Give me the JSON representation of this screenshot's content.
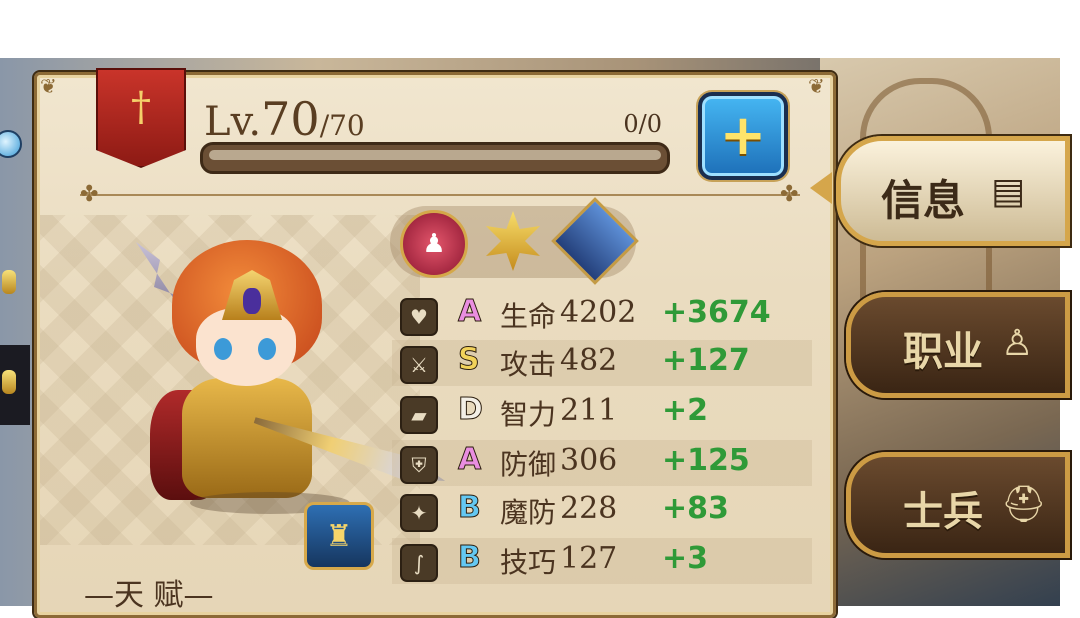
{
  "header": {
    "level_prefix": "Lv.",
    "level_current": "70",
    "level_max": "/70",
    "exp_text": "0/0",
    "exp_progress": 0,
    "plus_label": "+"
  },
  "role_icons": [
    "attack-class-icon",
    "star-rank-icon",
    "helmet-soldier-icon"
  ],
  "stats": [
    {
      "icon": "heart-icon",
      "icon_glyph": "♥",
      "grade": "A",
      "name": "生命",
      "value": "4202",
      "bonus": "+3674"
    },
    {
      "icon": "sword-icon",
      "icon_glyph": "⚔",
      "grade": "S",
      "name": "攻击",
      "value": "482",
      "bonus": "+127"
    },
    {
      "icon": "book-icon",
      "icon_glyph": "▰",
      "grade": "D",
      "name": "智力",
      "value": "211",
      "bonus": "+2"
    },
    {
      "icon": "shield-icon",
      "icon_glyph": "⛨",
      "grade": "A",
      "name": "防御",
      "value": "306",
      "bonus": "+125"
    },
    {
      "icon": "magic-shield-icon",
      "icon_glyph": "✦",
      "grade": "B",
      "name": "魔防",
      "value": "228",
      "bonus": "+83"
    },
    {
      "icon": "skill-icon",
      "icon_glyph": "∫",
      "grade": "B",
      "name": "技巧",
      "value": "127",
      "bonus": "+3"
    }
  ],
  "talent_label": "—天 赋—",
  "menu": {
    "info_label": "信息",
    "job_label": "职业",
    "soldier_label": "士兵"
  },
  "colors": {
    "bonus_green": "#2f9a38",
    "grade_A": "#e98ee0",
    "grade_S": "#f2d25a",
    "grade_B": "#64c8f2",
    "banner_red": "#c9342a",
    "plus_blue": "#1d6fb8"
  }
}
